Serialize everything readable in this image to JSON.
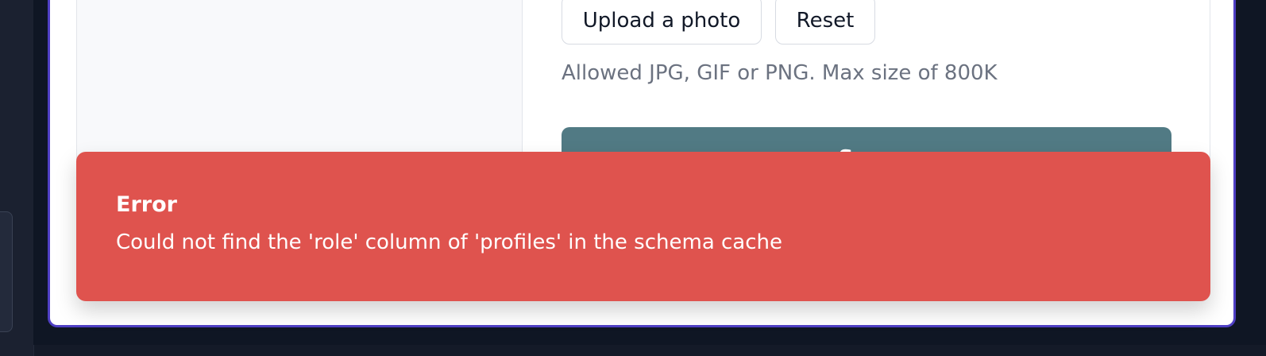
{
  "profile_form": {
    "upload_button_label": "Upload a photo",
    "reset_button_label": "Reset",
    "help_text": "Allowed JPG, GIF or PNG. Max size of 800K",
    "save_button_label": "Save"
  },
  "toast": {
    "title": "Error",
    "message": "Could not find the 'role' column of 'profiles' in the schema cache"
  },
  "colors": {
    "modal_border": "#4f3fc4",
    "save_button": "#517a84",
    "error_toast": "#df534e"
  }
}
